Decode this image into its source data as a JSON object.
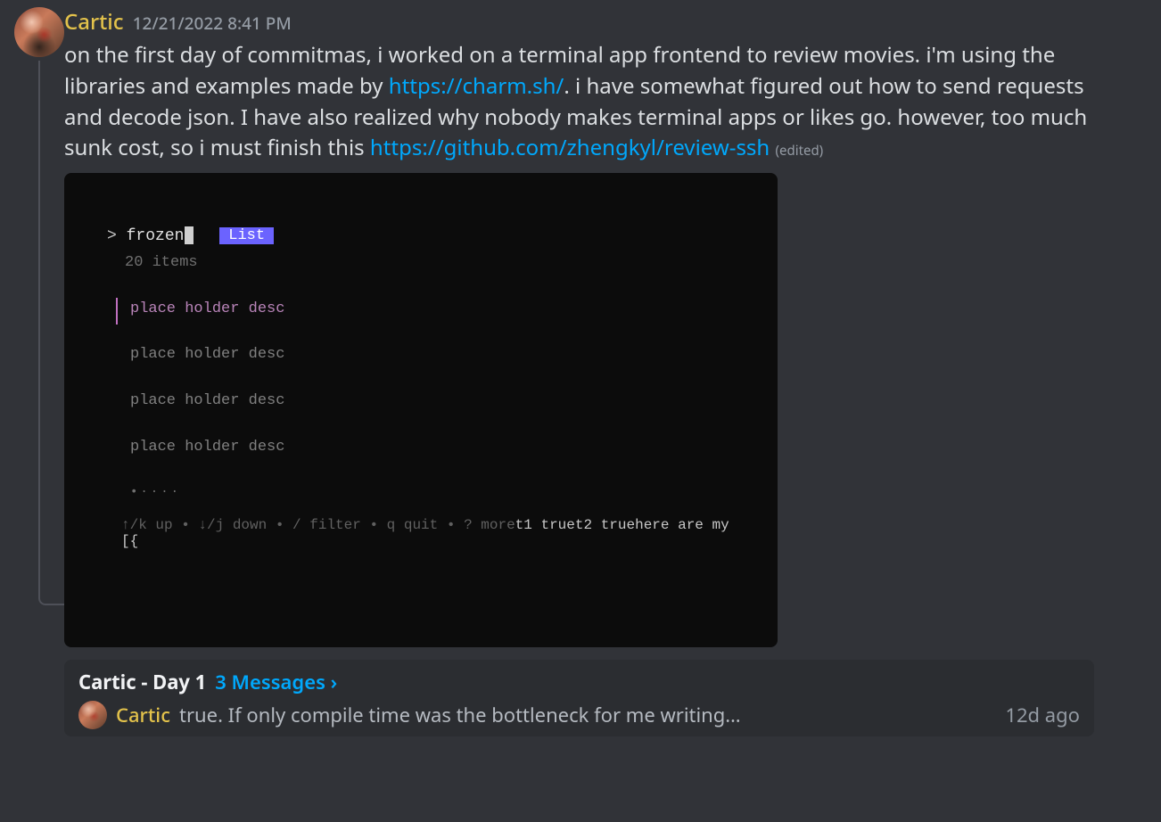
{
  "message": {
    "author": "Cartic",
    "timestamp": "12/21/2022 8:41 PM",
    "text_pre_link1": "on the first day of commitmas, i worked on a terminal app frontend to review movies. i'm using the libraries and examples made by ",
    "link1_text": "https://charm.sh/",
    "text_mid": ". i have somewhat figured out how to send requests and decode json. I have also realized why nobody makes terminal apps or likes go. however, too much sunk cost, so i must finish this ",
    "link2_text": "https://github.com/zhengkyl/review-ssh",
    "edited_label": "(edited)"
  },
  "terminal": {
    "prompt": ">",
    "query": "frozen",
    "badge": "List",
    "count": "20 items",
    "items": [
      "place holder desc",
      "place holder desc",
      "place holder desc",
      "place holder desc"
    ],
    "dots": "•····",
    "help_dim": "↑/k up • ↓/j down • / filter • q quit • ? more",
    "help_extra": "t1 truet2 truehere are my [{"
  },
  "thread": {
    "title": "Cartic - Day 1",
    "messages_label": "3 Messages ›",
    "preview_author": "Cartic",
    "preview_text": "true. If only compile time was the bottleneck for me writing…",
    "preview_ago": "12d ago"
  }
}
